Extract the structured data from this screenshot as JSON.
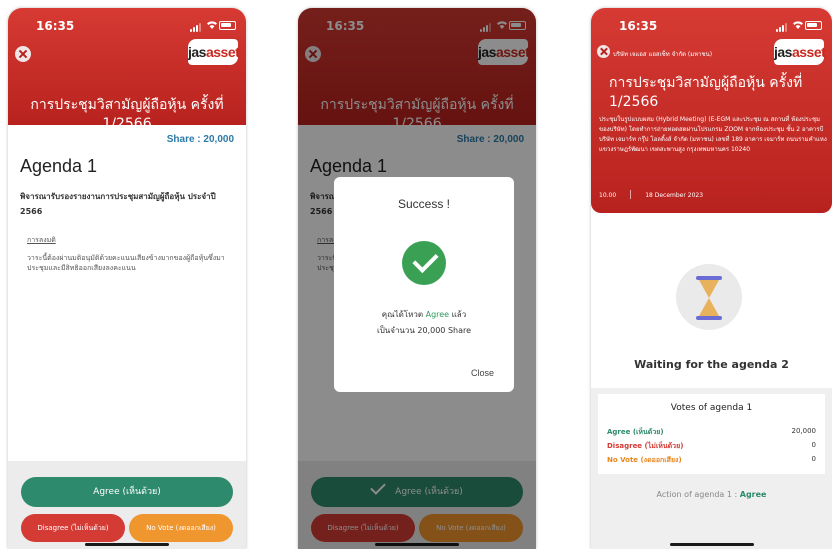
{
  "colors": {
    "brand_red": "#c9281f",
    "agree_green": "#2e8a6c",
    "disagree_red": "#d43b35",
    "novote_orange": "#f0962e",
    "share_blue": "#2a7aa8",
    "success_green": "#3aa154"
  },
  "status_bar": {
    "time": "16:35"
  },
  "logo": {
    "line1": "jas",
    "line2": "asset"
  },
  "meeting": {
    "title": "การประชุมวิสามัญผู้ถือหุ้น ครั้งที่ 1/2566",
    "company": "บริษัท เจแอส แอสเซ็ท จำกัด (มหาชน)",
    "description": "ประชุมในรูปแบบผสม (Hybrid Meeting) (E-EGM และประชุม ณ สถานที่ ห้องประชุมของบริษัท) โดยทำการถ่ายทอดสดผ่านโปรแกรม ZOOM จากห้องประชุม ชั้น 2 อาคารบี บริษัท เจมาร์ท กรุ๊ป โฮลดิ้งส์ จำกัด (มหาชน) เลขที่ 189 อาคาร เจมาร์ท ถนนรามคำแหง แขวงราษฎร์พัฒนา เขตสะพานสูง กรุงเทพมหานคร 10240",
    "time": "10.00",
    "date": "18 December 2023"
  },
  "agenda": {
    "share": "Share : 20,000",
    "heading": "Agenda 1",
    "desc": "พิจารณารับรองรายงานการประชุมสามัญผู้ถือหุ้น ประจำปี 2566",
    "resolution_label": "การลงมติ",
    "resolution_text": "วาระนี้ต้องผ่านมติอนุมัติด้วยคะแนนเสียงข้างมากของผู้ถือหุ้นซึ่งมาประชุมและมีสิทธิออกเสียงลงคะแนน"
  },
  "buttons": {
    "agree": "Agree (เห็นด้วย)",
    "disagree": "Disagree (ไม่เห็นด้วย)",
    "novote": "No Vote (งดออกเสียง)"
  },
  "modal": {
    "title": "Success !",
    "line1_pre": "คุณได้โหวต ",
    "line1_vote": "Agree",
    "line1_post": " แล้ว",
    "line2": "เป็นจำนวน 20,000 Share",
    "close": "Close"
  },
  "waiting": {
    "text": "Waiting for the agenda 2",
    "votes_title": "Votes of agenda 1",
    "rows": [
      {
        "label": "Agree (เห็นด้วย)",
        "value": "20,000"
      },
      {
        "label": "Disagree (ไม่เห็นด้วย)",
        "value": "0"
      },
      {
        "label": "No Vote (งดออกเสียง)",
        "value": "0"
      }
    ],
    "action_pre": "Action of agenda 1 : ",
    "action_value": "Agree"
  }
}
